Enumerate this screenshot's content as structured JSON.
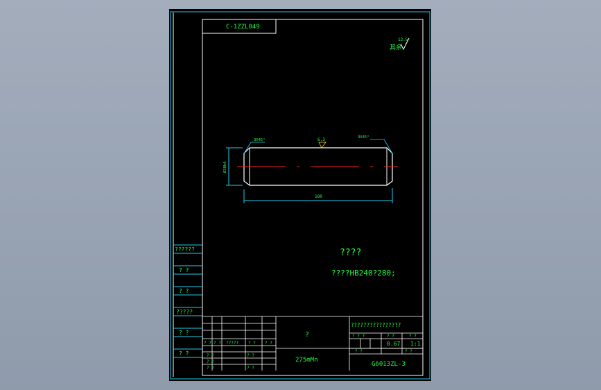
{
  "drawing_code": "C-1ZZL049",
  "surface_mark": {
    "value": "12.5",
    "label": "其余"
  },
  "dims": {
    "chamfer_left": "3X45°",
    "roughness_top": "6.3",
    "chamfer_right": "3X45°",
    "length": "180",
    "diameter": "Ø38h6"
  },
  "notes": {
    "title": "????",
    "body": "????HB240?280;"
  },
  "side_labels": [
    "??????",
    "? ?",
    "? ?",
    "?????",
    "? ?",
    "? ?"
  ],
  "title_block": {
    "part_name": "?",
    "material": "275mMn",
    "company": "????????????????",
    "row_a": [
      "? ? ?",
      "",
      "? ?",
      "? ?"
    ],
    "scale": "0.67",
    "ratio": "1:1",
    "row_b": [
      "? ?",
      "? ?"
    ],
    "number": "G6013ZL-3",
    "rev_left": [
      "? ?",
      "? ?",
      "?????",
      "? ?",
      "? ?"
    ],
    "rev_rows": [
      [
        "? ?",
        "",
        "? ?"
      ],
      [
        "? ?",
        "",
        ""
      ],
      [
        "? ?",
        "",
        "? ?"
      ],
      [
        "???",
        "",
        "? ?"
      ]
    ]
  }
}
